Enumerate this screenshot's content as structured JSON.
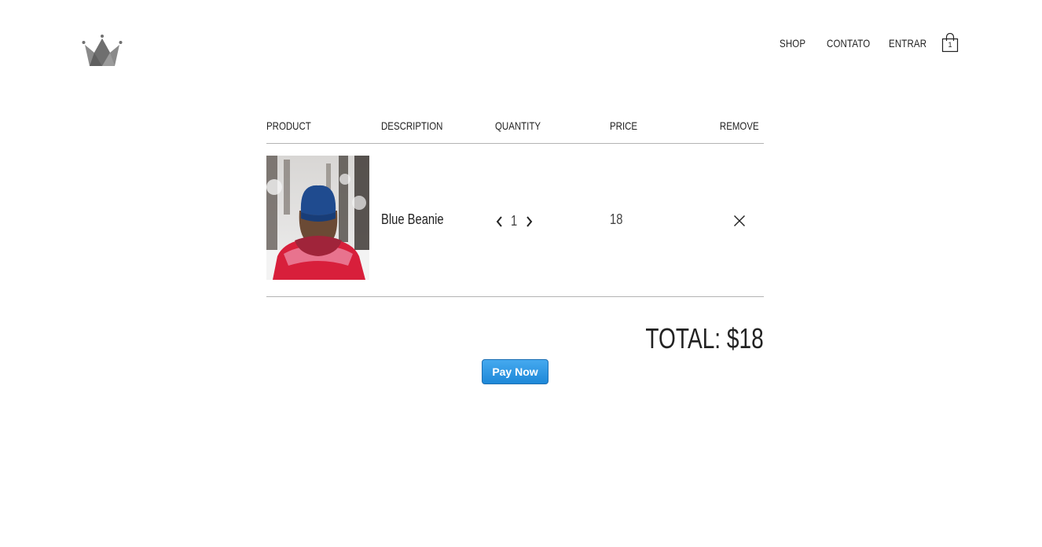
{
  "header": {
    "logo_icon": "crown-icon",
    "nav": {
      "shop": "SHOP",
      "contato": "CONTATO",
      "entrar": "ENTRAR"
    },
    "cart_icon": "shopping-bag-icon",
    "cart_count": "1"
  },
  "cart": {
    "columns": {
      "product": "PRODUCT",
      "description": "DESCRIPTION",
      "quantity": "QUANTITY",
      "price": "PRICE",
      "remove": "REMOVE"
    },
    "items": [
      {
        "image_icon": "product-photo-blue-beanie",
        "description": "Blue Beanie",
        "quantity": "1",
        "price": "18",
        "remove_icon": "close-icon",
        "decrease_icon": "chevron-left-icon",
        "increase_icon": "chevron-right-icon"
      }
    ],
    "total": "TOTAL: $18"
  },
  "pay_button": {
    "label": "Pay Now",
    "color": "#2b95e3"
  }
}
